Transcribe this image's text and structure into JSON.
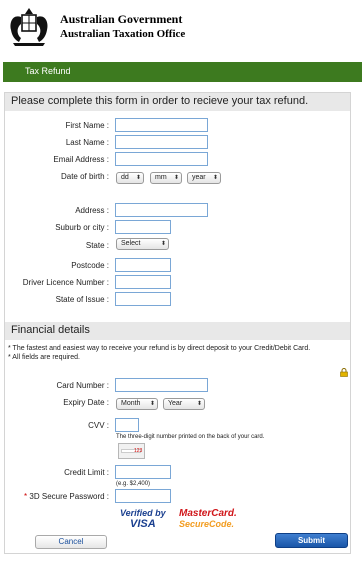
{
  "header": {
    "title": "Australian Government",
    "subtitle": "Australian Taxation Office"
  },
  "nav": {
    "tab": "Tax Refund"
  },
  "form": {
    "intro": "Please complete this form in order to recieve your tax refund.",
    "first_name_label": "First Name :",
    "last_name_label": "Last Name :",
    "email_label": "Email Address :",
    "dob_label": "Date of birth :",
    "dob_day": "dd",
    "dob_month": "mm",
    "dob_year": "year",
    "address_label": "Address :",
    "suburb_label": "Suburb or city :",
    "state_label": "State :",
    "state_value": "Select",
    "postcode_label": "Postcode :",
    "licence_label": "Driver Licence Number :",
    "issue_state_label": "State of Issue :"
  },
  "financial": {
    "heading": "Financial details",
    "note1": "* The fastest and easiest way to receive your refund is by direct deposit to your Credit/Debit Card.",
    "note2": "* All fields are required.",
    "card_label": "Card Number :",
    "expiry_label": "Expiry Date :",
    "expiry_month": "Month",
    "expiry_year": "Year",
    "cvv_label": "CVV :",
    "cvv_help": "The three-digit number printed on the back of your card.",
    "credit_limit_label": "Credit Limit :",
    "credit_limit_hint": "(e.g. $2,400)",
    "secure_label": "3D Secure Password :",
    "secure_star": "*",
    "visa_line1": "Verified by",
    "visa_line2": "VISA",
    "mc_line1": "MasterCard.",
    "mc_line2": "SecureCode."
  },
  "buttons": {
    "cancel": "Cancel",
    "submit": "Submit"
  },
  "colors": {
    "nav_green": "#3d7a1f",
    "input_border": "#7aa7d6",
    "submit_blue": "#1a56a8",
    "required_red": "#cc0000"
  }
}
